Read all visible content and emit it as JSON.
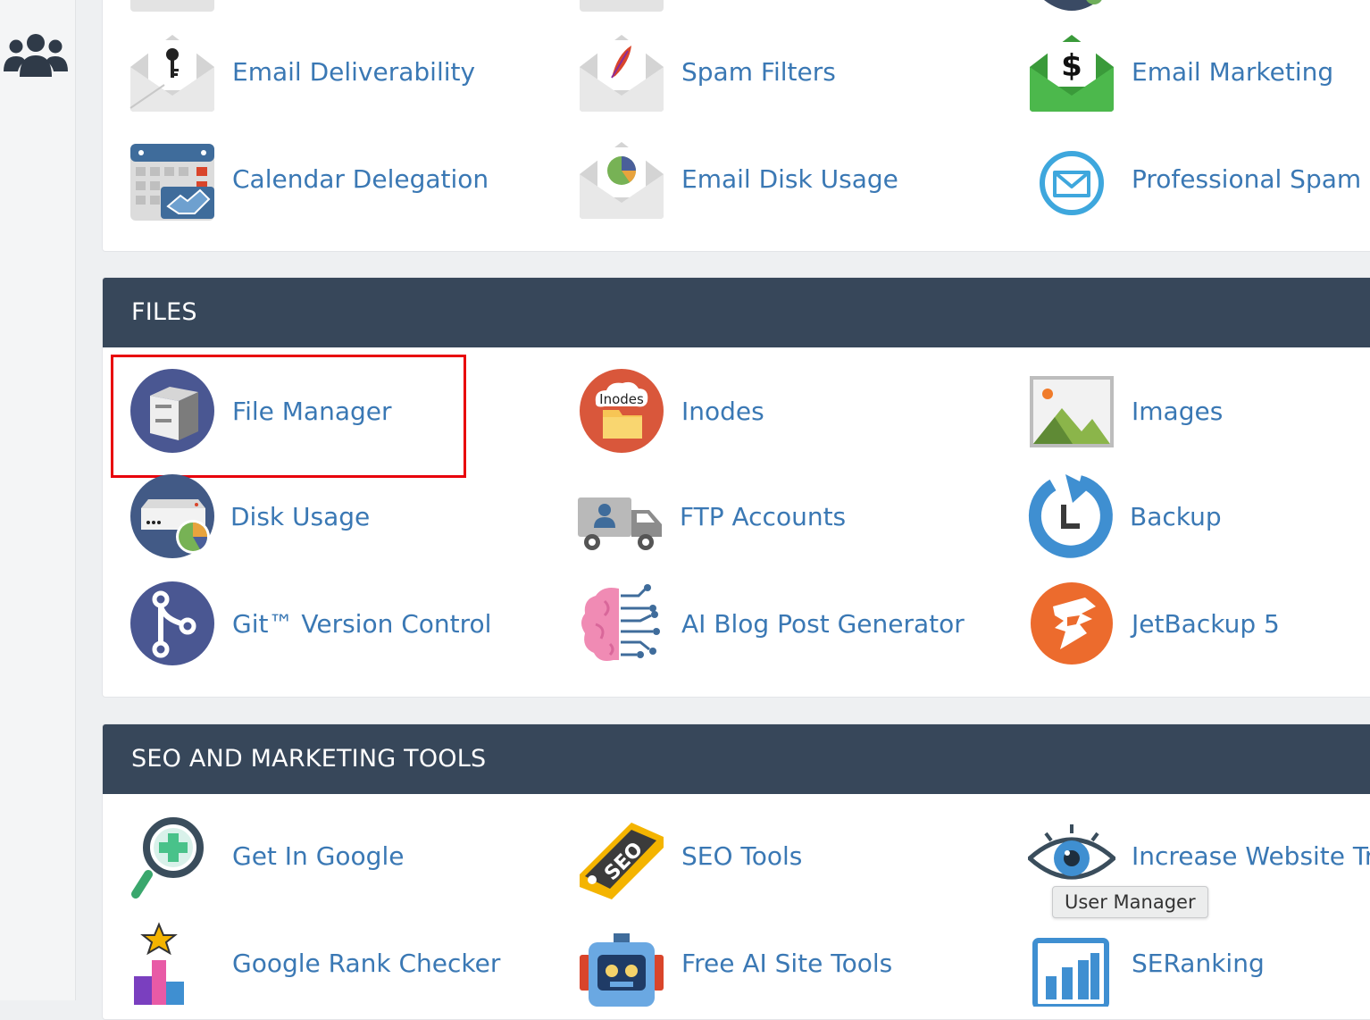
{
  "sidebar": {
    "icon": "users-icon"
  },
  "email_panel": {
    "items": [
      {
        "label": "Email Deliverability",
        "icon": "envelope-key-icon"
      },
      {
        "label": "Spam Filters",
        "icon": "envelope-feather-icon"
      },
      {
        "label": "Email Marketing",
        "icon": "envelope-dollar-icon"
      },
      {
        "label": "Calendar Delegation",
        "icon": "calendar-handshake-icon"
      },
      {
        "label": "Email Disk Usage",
        "icon": "envelope-pie-icon"
      },
      {
        "label": "Professional Spam Fi",
        "icon": "circle-envelope-icon"
      }
    ]
  },
  "files_panel": {
    "title": "FILES",
    "items": [
      {
        "label": "File Manager",
        "icon": "file-cabinet-icon"
      },
      {
        "label": "Inodes",
        "icon": "inodes-folder-icon",
        "badge": "Inodes"
      },
      {
        "label": "Images",
        "icon": "image-landscape-icon"
      },
      {
        "label": "Disk Usage",
        "icon": "server-pie-icon"
      },
      {
        "label": "FTP Accounts",
        "icon": "truck-user-icon"
      },
      {
        "label": "Backup",
        "icon": "backup-clock-icon"
      },
      {
        "label": "Git™ Version Control",
        "icon": "git-branch-icon"
      },
      {
        "label": "AI Blog Post Generator",
        "icon": "brain-circuit-icon"
      },
      {
        "label": "JetBackup 5",
        "icon": "jetbackup-icon"
      }
    ]
  },
  "seo_panel": {
    "title": "SEO AND MARKETING TOOLS",
    "items": [
      {
        "label": "Get In Google",
        "icon": "magnifier-plus-icon"
      },
      {
        "label": "SEO Tools",
        "icon": "seo-tag-icon",
        "badge": "SEO"
      },
      {
        "label": "Increase Website Tra",
        "icon": "eye-icon"
      },
      {
        "label": "Google Rank Checker",
        "icon": "rank-chart-star-icon"
      },
      {
        "label": "Free AI Site Tools",
        "icon": "robot-icon"
      },
      {
        "label": "SERanking",
        "icon": "bar-chart-icon"
      }
    ]
  },
  "tooltip": {
    "text": "User Manager"
  },
  "colors": {
    "header_bg": "#37475a",
    "link": "#3a78b4",
    "highlight": "#e8000b"
  }
}
